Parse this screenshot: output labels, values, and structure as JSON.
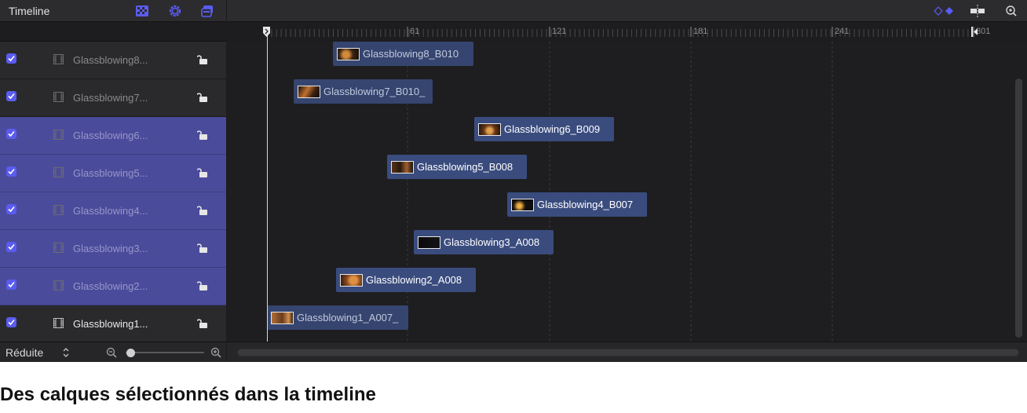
{
  "panel": {
    "title": "Timeline",
    "header_icons": [
      "checkerboard-icon",
      "gear-icon",
      "layers-icon"
    ]
  },
  "layers": [
    {
      "name": "Glassblowing8...",
      "enabled": true,
      "selected": false
    },
    {
      "name": "Glassblowing7...",
      "enabled": true,
      "selected": false
    },
    {
      "name": "Glassblowing6...",
      "enabled": true,
      "selected": true
    },
    {
      "name": "Glassblowing5...",
      "enabled": true,
      "selected": true
    },
    {
      "name": "Glassblowing4...",
      "enabled": true,
      "selected": true
    },
    {
      "name": "Glassblowing3...",
      "enabled": true,
      "selected": true
    },
    {
      "name": "Glassblowing2...",
      "enabled": true,
      "selected": true
    },
    {
      "name": "Glassblowing1...",
      "enabled": true,
      "selected": false
    }
  ],
  "footer": {
    "view_mode": "Réduite"
  },
  "ruler": {
    "ticks": [
      "61",
      "121",
      "181",
      "241",
      "301"
    ]
  },
  "clips": [
    {
      "label": "Glassblowing8_B010",
      "selected": false
    },
    {
      "label": "Glassblowing7_B010_",
      "selected": false
    },
    {
      "label": "Glassblowing6_B009",
      "selected": true
    },
    {
      "label": "Glassblowing5_B008",
      "selected": true
    },
    {
      "label": "Glassblowing4_B007",
      "selected": true
    },
    {
      "label": "Glassblowing3_A008",
      "selected": true
    },
    {
      "label": "Glassblowing2_A008",
      "selected": true
    },
    {
      "label": "Glassblowing1_A007_",
      "selected": false
    }
  ],
  "toolbar_icons": [
    "keyframe-diamond-icon",
    "snapping-icon",
    "zoom-icon"
  ],
  "caption": "Des calques sélectionnés dans la timeline",
  "colors": {
    "selection": "#4b4b9c",
    "clip": "#35456f",
    "checkbox": "#5a5cf0",
    "accent": "#5b5cf6"
  }
}
